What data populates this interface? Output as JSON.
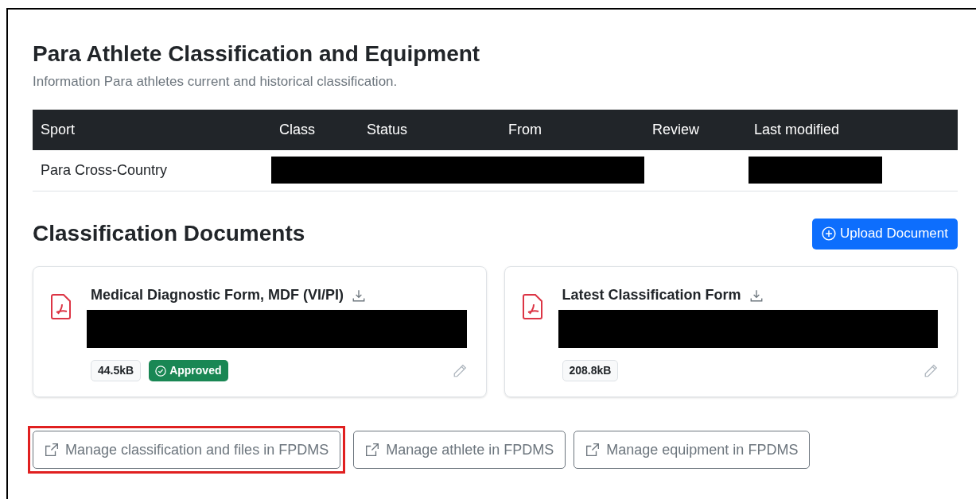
{
  "section": {
    "title": "Para Athlete Classification and Equipment",
    "subtitle": "Information Para athletes current and historical classification."
  },
  "table": {
    "columns": [
      "Sport",
      "Class",
      "Status",
      "From",
      "Review",
      "Last modified"
    ],
    "rows": [
      {
        "cells": [
          {
            "kind": "text",
            "text": "Para Cross-Country"
          },
          {
            "kind": "redacted"
          },
          {
            "kind": "redacted"
          },
          {
            "kind": "redacted"
          },
          {
            "kind": "empty"
          },
          {
            "kind": "redacted"
          }
        ]
      }
    ]
  },
  "documents": {
    "title": "Classification Documents",
    "upload_button": "Upload Document",
    "items": [
      {
        "name": "Medical Diagnostic Form, MDF (VI/PI)",
        "description_redacted": true,
        "size": "44.5kB",
        "status": "Approved"
      },
      {
        "name": "Latest Classification Form",
        "description_redacted": true,
        "size": "208.8kB"
      }
    ]
  },
  "actions": [
    {
      "label": "Manage classification and files in FPDMS",
      "highlighted": true
    },
    {
      "label": "Manage athlete in FPDMS",
      "highlighted": false
    },
    {
      "label": "Manage equipment in FPDMS",
      "highlighted": false
    }
  ]
}
